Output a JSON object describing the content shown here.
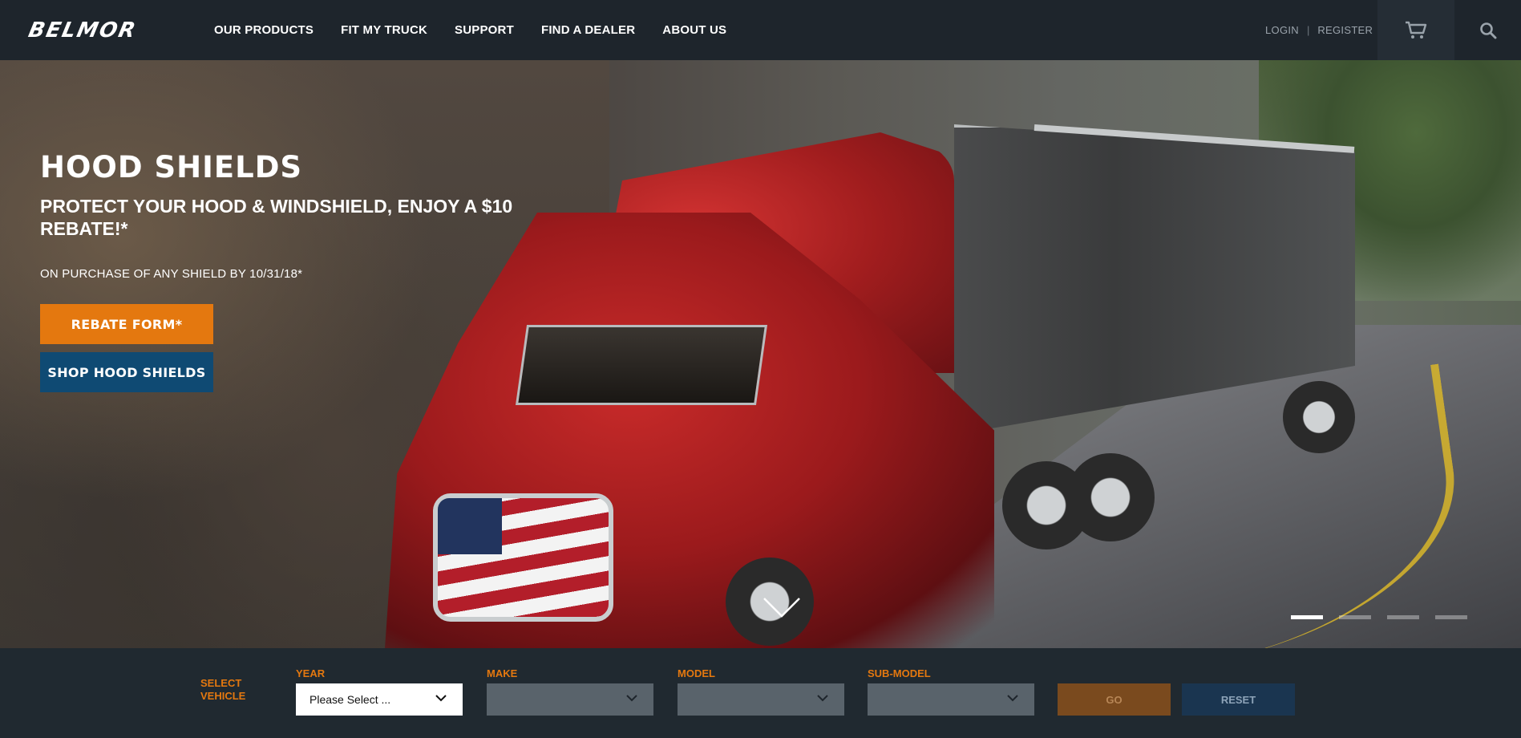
{
  "header": {
    "logo_text": "BELMOR",
    "nav": [
      "OUR PRODUCTS",
      "FIT MY TRUCK",
      "SUPPORT",
      "FIND A DEALER",
      "ABOUT US"
    ],
    "login": "LOGIN",
    "separator": "|",
    "register": "REGISTER",
    "cart_icon": "cart-icon",
    "search_icon": "search-icon"
  },
  "hero": {
    "title": "HOOD SHIELDS",
    "subtitle": "PROTECT YOUR HOOD & WINDSHIELD, ENJOY A $10 REBATE!*",
    "note": "ON PURCHASE OF ANY SHIELD BY 10/31/18*",
    "primary_button": "REBATE FORM*",
    "secondary_button": "SHOP HOOD SHIELDS",
    "slide_count": 4,
    "active_slide": 1,
    "scroll_icon": "chevron-down-icon"
  },
  "selector": {
    "label": "SELECT VEHICLE",
    "fields": [
      {
        "label": "YEAR",
        "value": "Please Select ...",
        "enabled": true
      },
      {
        "label": "MAKE",
        "value": "",
        "enabled": false
      },
      {
        "label": "MODEL",
        "value": "",
        "enabled": false
      },
      {
        "label": "SUB-MODEL",
        "value": "",
        "enabled": false
      }
    ],
    "go_label": "GO",
    "reset_label": "RESET"
  },
  "colors": {
    "accent_orange": "#e4780f",
    "accent_blue": "#0f4a73",
    "header_bg": "#1e252c"
  }
}
